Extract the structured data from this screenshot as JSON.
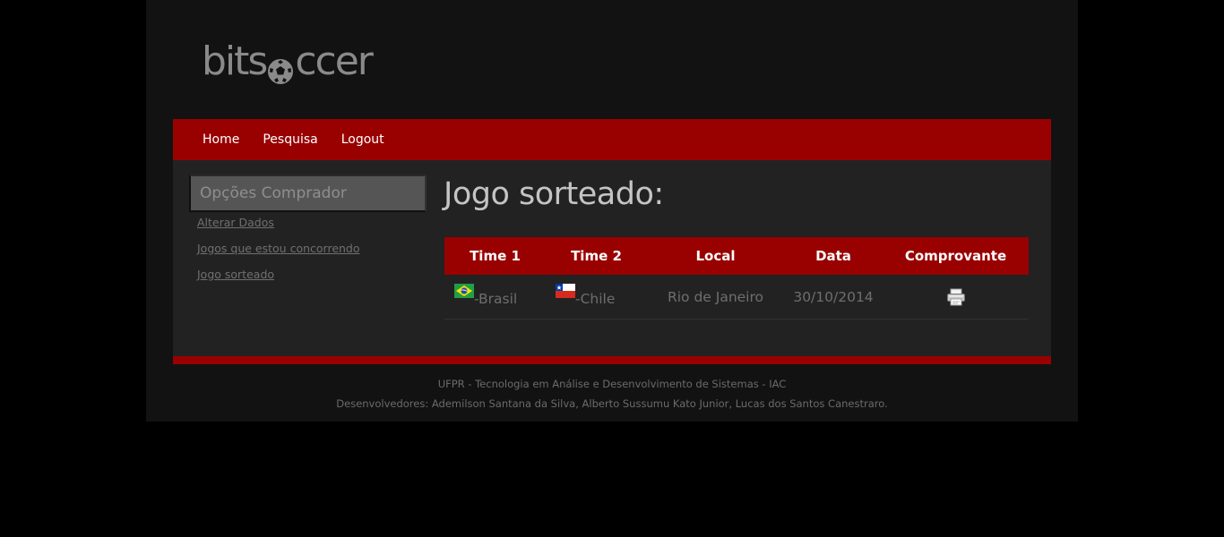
{
  "logo": {
    "text_before": "bits",
    "text_after": "ccer",
    "icon": "soccer-ball-icon"
  },
  "nav": {
    "items": [
      {
        "label": "Home"
      },
      {
        "label": "Pesquisa"
      },
      {
        "label": "Logout"
      }
    ]
  },
  "sidebar": {
    "title": "Opções Comprador",
    "links": [
      {
        "label": "Alterar Dados"
      },
      {
        "label": "Jogos que estou concorrendo"
      },
      {
        "label": "Jogo sorteado"
      }
    ]
  },
  "main": {
    "title": "Jogo sorteado:",
    "table": {
      "headers": [
        "Time 1",
        "Time 2",
        "Local",
        "Data",
        "Comprovante"
      ],
      "rows": [
        {
          "team1": "-Brasil",
          "team1_flag": "brazil-flag-icon",
          "team2": "-Chile",
          "team2_flag": "chile-flag-icon",
          "local": "Rio de Janeiro",
          "data": "30/10/2014",
          "comprovante_icon": "printer-icon"
        }
      ]
    }
  },
  "footer": {
    "line1": "UFPR - Tecnologia em Análise e Desenvolvimento de Sistemas - IAC",
    "line2": "Desenvolvedores: Ademilson Santana da Silva, Alberto Sussumu Kato Junior, Lucas dos Santos Canestraro."
  },
  "colors": {
    "brand_red": "#990000",
    "page_background": "#000000",
    "wrapper_background": "#121212",
    "content_background": "#222222"
  }
}
